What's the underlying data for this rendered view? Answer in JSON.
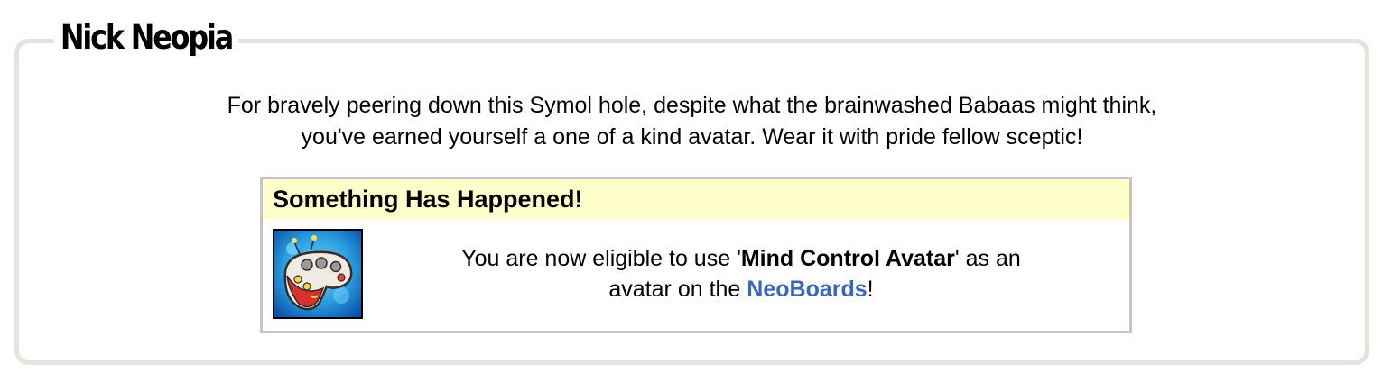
{
  "page": {
    "title": "Nick Neopia",
    "intro_line1": "For bravely peering down this Symol hole, despite what the brainwashed Babaas might think,",
    "intro_line2": "you've earned yourself a one of a kind avatar. Wear it with pride fellow sceptic!"
  },
  "notice": {
    "heading": "Something Has Happened!",
    "avatar_icon": "mind-control-avatar-icon",
    "msg_prefix": "You are now eligible to use '",
    "avatar_name": "Mind Control Avatar",
    "msg_middle": "' as an",
    "msg_line2_prefix": "avatar on the ",
    "link_text": "NeoBoards",
    "msg_suffix": "!"
  },
  "colors": {
    "frame_border": "#e4e4dc",
    "notice_header_bg": "#ffffcc",
    "notice_border": "#c4c4c4",
    "link": "#3a66bd"
  }
}
